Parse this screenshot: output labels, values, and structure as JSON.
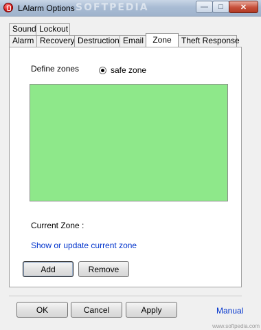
{
  "window": {
    "title": "LAlarm Options",
    "watermark": "SOFTPEDIA",
    "watermark_sub": "www.softpedia.com",
    "buttons": {
      "minimize": "—",
      "maximize": "□",
      "close": "✕"
    }
  },
  "tabs": {
    "back_row": [
      {
        "label": "Sound"
      },
      {
        "label": "Lockout"
      }
    ],
    "front_row": [
      {
        "label": "Alarm"
      },
      {
        "label": "Recovery"
      },
      {
        "label": "Destruction"
      },
      {
        "label": "Email"
      },
      {
        "label": "Zone",
        "selected": true
      },
      {
        "label": "Theft Response"
      }
    ]
  },
  "zone_panel": {
    "define_label": "Define zones",
    "radio_label": "safe zone",
    "zone_fill_color": "#8ee88a",
    "current_zone_label": "Current Zone :",
    "update_link": "Show or update current zone",
    "add_button": "Add",
    "remove_button": "Remove"
  },
  "footer": {
    "ok_button": "OK",
    "cancel_button": "Cancel",
    "apply_button": "Apply",
    "manual_link": "Manual"
  },
  "colors": {
    "link": "#0033cc",
    "zone": "#8ee88a"
  }
}
